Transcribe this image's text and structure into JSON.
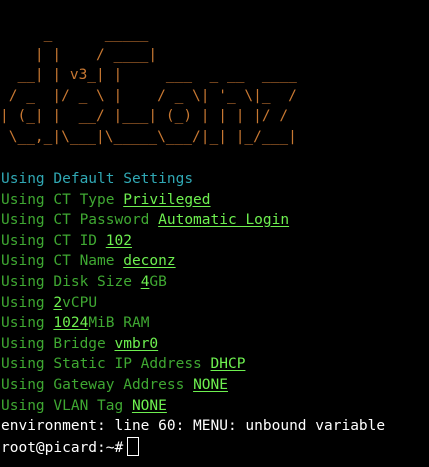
{
  "colors": {
    "background": "#000000",
    "banner": "#c87832",
    "default_settings": "#30a8b4",
    "label": "#3fa832",
    "value": "#6ef050",
    "plain": "#ffffff"
  },
  "banner_lines": [
    "     _      _____",
    "    | |    / ____|",
    "  __| | v3_| |     ___  _ __  ____",
    " / _  |/ _ \\ |    / _ \\| '_ \\|_  /",
    "| (_| |  __/ |___| (_) | | | |/ /",
    " \\__,_|\\___|\\_____\\___/|_| |_/___|"
  ],
  "default_settings": "Using Default Settings",
  "settings": [
    {
      "pre": "Using CT Type ",
      "value": "Privileged",
      "post": ""
    },
    {
      "pre": "Using CT Password ",
      "value": "Automatic Login",
      "post": ""
    },
    {
      "pre": "Using CT ID ",
      "value": "102",
      "post": ""
    },
    {
      "pre": "Using CT Name ",
      "value": "deconz",
      "post": ""
    },
    {
      "pre": "Using Disk Size ",
      "value": "4",
      "post": "GB"
    },
    {
      "pre": "Using ",
      "value": "2",
      "post": "vCPU"
    },
    {
      "pre": "Using ",
      "value": "1024",
      "post": "MiB RAM"
    },
    {
      "pre": "Using Bridge ",
      "value": "vmbr0",
      "post": ""
    },
    {
      "pre": "Using Static IP Address ",
      "value": "DHCP",
      "post": ""
    },
    {
      "pre": "Using Gateway Address ",
      "value": "NONE",
      "post": ""
    },
    {
      "pre": "Using VLAN Tag ",
      "value": "NONE",
      "post": ""
    }
  ],
  "error_line": "environment: line 60: MENU: unbound variable",
  "prompt": "root@picard:~#"
}
